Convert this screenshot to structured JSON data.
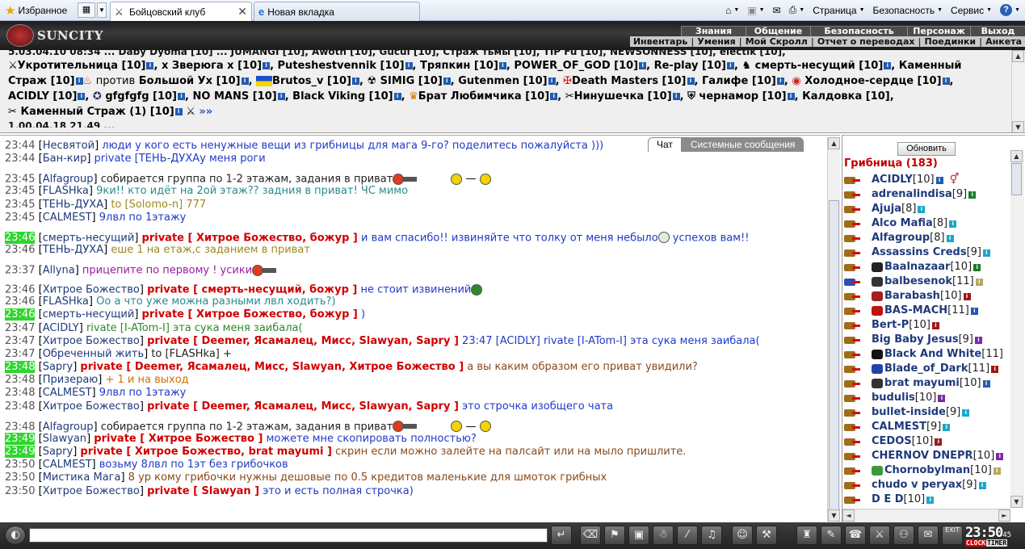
{
  "browser": {
    "favorites": "Избранное",
    "tabs": [
      {
        "label": "Бойцовский клуб"
      },
      {
        "label": "Новая вкладка"
      }
    ],
    "tools": [
      "Страница",
      "Безопасность",
      "Сервис"
    ]
  },
  "header": {
    "logo": "SUNCITY",
    "menu_top": [
      "Знания",
      "Общение",
      "Безопасность",
      "Персонаж",
      "Выход"
    ],
    "menu_bottom": [
      "Инвентарь",
      "Умения",
      "Мой Скролл",
      "Отчет о переводах",
      "Поединки",
      "Анкета"
    ]
  },
  "online": {
    "line0": "5.03.04.10 08:34 ... Daby Dyoma [10] ... JUMANGI [10], Awoth [10], Gucul [10], Страж тьмы [10], TIP Fu [10], NEWSONNESS [10], electik [10],",
    "line1": [
      "Укротительница [10]",
      "х Зверюга x [10]",
      "Puteshestvennik [10]",
      "Тряпкин [10]",
      "POWER_OF_GOD [10]",
      "Re-play [10]",
      "смерть-несущий [10]",
      "Каменный"
    ],
    "line2": [
      "Страж [10]",
      "против",
      "Большой Ух [10]",
      "Brutos_v [10]",
      "SIMIG [10]",
      "Gutenmen [10]",
      "Death Masters [10]",
      "Галифе [10]",
      "Холодное-сердце [10]"
    ],
    "line3": [
      "ACIDLY [10]",
      "gfgfgfg [10]",
      "NO MANS [10]",
      "Black Viking [10]",
      "Брат Любимчика [10]",
      "Нинушечка [10]",
      "чернамор [10]",
      "Калдовка [10],"
    ],
    "line4": [
      "Каменный Страж (1) [10]",
      "»»"
    ]
  },
  "chat": {
    "tabs": [
      "Чат",
      "Системные сообщения"
    ],
    "lines": [
      {
        "time": "23:44",
        "nick": "Несвятой",
        "to": "",
        "text": "люди у кого есть ненужные вещи из грибницы для мага 9-го? поделитесь пожалуйста )))",
        "cls": "blue"
      },
      {
        "time": "23:44",
        "nick": "Бан-кир",
        "to": "",
        "text": "private [ТЕНЬ-ДУХАу меня роги",
        "cls": "blue"
      },
      {
        "time": "23:45",
        "nick": "Alfagroup",
        "to": "",
        "text": "собирается группа по 1-2 этажам, задания в приват",
        "cls": "dark"
      },
      {
        "time": "23:45",
        "nick": "FLASHka",
        "to": "",
        "text": "9ки!! кто идёт на 2ой этаж?? задния в приват! ЧС мимо",
        "cls": "teal"
      },
      {
        "time": "23:45",
        "nick": "ТЕНЬ-ДУХА",
        "to": "",
        "text": "to [Solomo-n] 777",
        "cls": "olive"
      },
      {
        "time": "23:45",
        "nick": "CALMEST",
        "to": "",
        "text": "9лвл по 1этажу",
        "cls": "blue"
      },
      {
        "time": "23:46",
        "nick": "смерть-несущий",
        "to": "private [ Хитрое Божество, божур ]",
        "text": "и вам спасибо!! извиняйте что толку от меня небыло",
        "text2": "успехов вам!!",
        "cls": "blue"
      },
      {
        "time": "23:46",
        "nick": "ТЕНЬ-ДУХА",
        "to": "",
        "text": "еше 1 на етаж,с заданием в приват",
        "cls": "olive"
      },
      {
        "time": "23:37",
        "nick": "Allyna",
        "to": "",
        "text": "прицепите по первому ! усики",
        "cls": "purple"
      },
      {
        "time": "23:46",
        "nick": "Хитрое Божество",
        "to": "private [ смерть-несущий, божур ]",
        "text": "не стоит извинений",
        "cls": "blue"
      },
      {
        "time": "23:46",
        "nick": "FLASHka",
        "to": "",
        "text": "Оо а что уже можна разными лвл ходить?)",
        "cls": "teal"
      },
      {
        "time": "23:46",
        "nick": "смерть-несущий",
        "to": "private [ Хитрое Божество, божур ]",
        "text": ")",
        "cls": "blue"
      },
      {
        "time": "23:47",
        "nick": "ACIDLY",
        "to": "",
        "text": "rivate [I-ATom-I] эта сука меня заибала(",
        "cls": "green"
      },
      {
        "time": "23:47",
        "nick": "Хитрое Божество",
        "to": "private [ Deemer, Ясамалец, Мисс, Slawyan, Sapry ]",
        "text": "23:47 [ACIDLY] rivate [I-ATom-I] эта сука меня заибала(",
        "cls": "blue"
      },
      {
        "time": "23:47",
        "nick": "Обреченный жить",
        "to": "",
        "text": "to [FLASHka] +",
        "cls": "dark"
      },
      {
        "time": "23:48",
        "nick": "Sapry",
        "to": "private [ Deemer, Ясамалец, Мисс, Slawyan, Хитрое Божество ]",
        "text": "а вы каким образом его приват увидили?",
        "cls": "brown"
      },
      {
        "time": "23:48",
        "nick": "Призераю",
        "to": "",
        "text": "+ 1 и на выход",
        "cls": "orange"
      },
      {
        "time": "23:48",
        "nick": "CALMEST",
        "to": "",
        "text": "9лвл по 1этажу",
        "cls": "blue"
      },
      {
        "time": "23:48",
        "nick": "Хитрое Божество",
        "to": "private [ Deemer, Ясамалец, Мисс, Slawyan, Sapry ]",
        "text": "это строчка изобщего чата",
        "cls": "blue"
      },
      {
        "time": "23:48",
        "nick": "Alfagroup",
        "to": "",
        "text": "собирается группа по 1-2 этажам, задания в приват",
        "cls": "dark"
      },
      {
        "time": "23:49",
        "nick": "Slawyan",
        "to": "private [ Хитрое Божество ]",
        "text": "можете мне скопировать полностью?",
        "cls": "blue"
      },
      {
        "time": "23:49",
        "nick": "Sapry",
        "to": "private [ Хитрое Божество, brat mayumi ]",
        "text": "скрин если можно залейте на палсайт или на мыло пришлите.",
        "cls": "brown"
      },
      {
        "time": "23:50",
        "nick": "CALMEST",
        "to": "",
        "text": "возьму 8лвл по 1эт без грибочков",
        "cls": "blue"
      },
      {
        "time": "23:50",
        "nick": "Мистика Мага",
        "to": "",
        "text": "8 ур кому грибочки нужны дешовые по 0.5 кредитов маленькие для шмоток грибных",
        "cls": "brown"
      },
      {
        "time": "23:50",
        "nick": "Хитрое Божество",
        "to": "private [ Slawyan ]",
        "text": "это и есть полная строчка)",
        "cls": "blue"
      }
    ]
  },
  "room": {
    "refresh": "Обновить",
    "title": "Грибница (183)",
    "users": [
      {
        "name": "ACIDLY",
        "lvl": "[10]",
        "b": "blue"
      },
      {
        "name": "adrenalindisa",
        "lvl": "[9]",
        "b": "green"
      },
      {
        "name": "Ajuja",
        "lvl": "[8]",
        "b": "cyan"
      },
      {
        "name": "Alco Mafia",
        "lvl": "[8]",
        "b": "cyan"
      },
      {
        "name": "Alfagroup",
        "lvl": "[8]",
        "b": "cyan"
      },
      {
        "name": "Assassins Creds",
        "lvl": "[9]",
        "b": "cyan"
      },
      {
        "name": "Baalnazaar",
        "lvl": "[10]",
        "b": "green"
      },
      {
        "name": "balbesenok",
        "lvl": "[11]",
        "b": "khaki"
      },
      {
        "name": "Barabash",
        "lvl": "[10]",
        "b": "red"
      },
      {
        "name": "BAS-MACH",
        "lvl": "[11]",
        "b": "blue"
      },
      {
        "name": "Bert-P",
        "lvl": "[10]",
        "b": "red"
      },
      {
        "name": "Big Baby Jesus",
        "lvl": "[9]",
        "b": "purple"
      },
      {
        "name": "Black And White",
        "lvl": "[11]",
        "b": ""
      },
      {
        "name": "Blade_of_Dark",
        "lvl": "[11]",
        "b": "red"
      },
      {
        "name": "brat mayumi",
        "lvl": "[10]",
        "b": "blue"
      },
      {
        "name": "budulis",
        "lvl": "[10]",
        "b": "purple"
      },
      {
        "name": "bullet-inside",
        "lvl": "[9]",
        "b": "cyan"
      },
      {
        "name": "CALMEST",
        "lvl": "[9]",
        "b": "cyan"
      },
      {
        "name": "CEDOS",
        "lvl": "[10]",
        "b": "red"
      },
      {
        "name": "CHERNOV DNEPR",
        "lvl": "[10]",
        "b": "purple"
      },
      {
        "name": "Chornobylman",
        "lvl": "[10]",
        "b": "khaki"
      },
      {
        "name": "chudo v peryax",
        "lvl": "[9]",
        "b": "cyan"
      },
      {
        "name": "D E D",
        "lvl": "[10]",
        "b": "cyan"
      }
    ]
  },
  "bottom": {
    "time": "23:50",
    "sec": "45",
    "clock_label": "CLOCK",
    "timer_label": "TIMER",
    "exit_label": "EXIT"
  }
}
